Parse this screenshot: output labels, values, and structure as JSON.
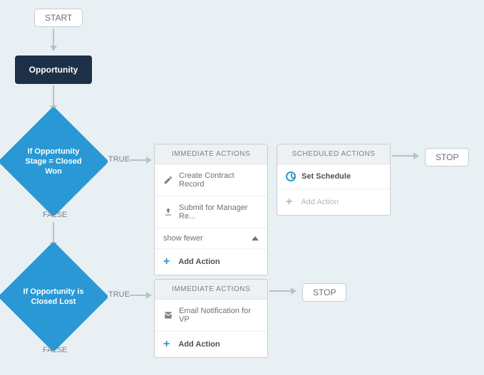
{
  "start": {
    "label": "START"
  },
  "stop1": {
    "label": "STOP"
  },
  "stop2": {
    "label": "STOP"
  },
  "object_node": {
    "label": "Opportunity"
  },
  "branch1": {
    "condition": "If Opportunity Stage = Closed Won",
    "true_label": "TRUE",
    "false_label": "FALSE"
  },
  "branch2": {
    "condition": "If Opportunity is Closed Lost",
    "true_label": "TRUE",
    "false_label": "FALSE"
  },
  "immediate1": {
    "header": "IMMEDIATE ACTIONS",
    "items": [
      {
        "icon": "pencil",
        "label": "Create Contract Record"
      },
      {
        "icon": "submit",
        "label": "Submit for Manager Re..."
      }
    ],
    "show_fewer": "show fewer",
    "add": "Add Action"
  },
  "scheduled1": {
    "header": "SCHEDULED ACTIONS",
    "set": "Set Schedule",
    "add": "Add Action"
  },
  "immediate2": {
    "header": "IMMEDIATE ACTIONS",
    "items": [
      {
        "icon": "mail",
        "label": "Email Notification for VP"
      }
    ],
    "add": "Add Action"
  }
}
